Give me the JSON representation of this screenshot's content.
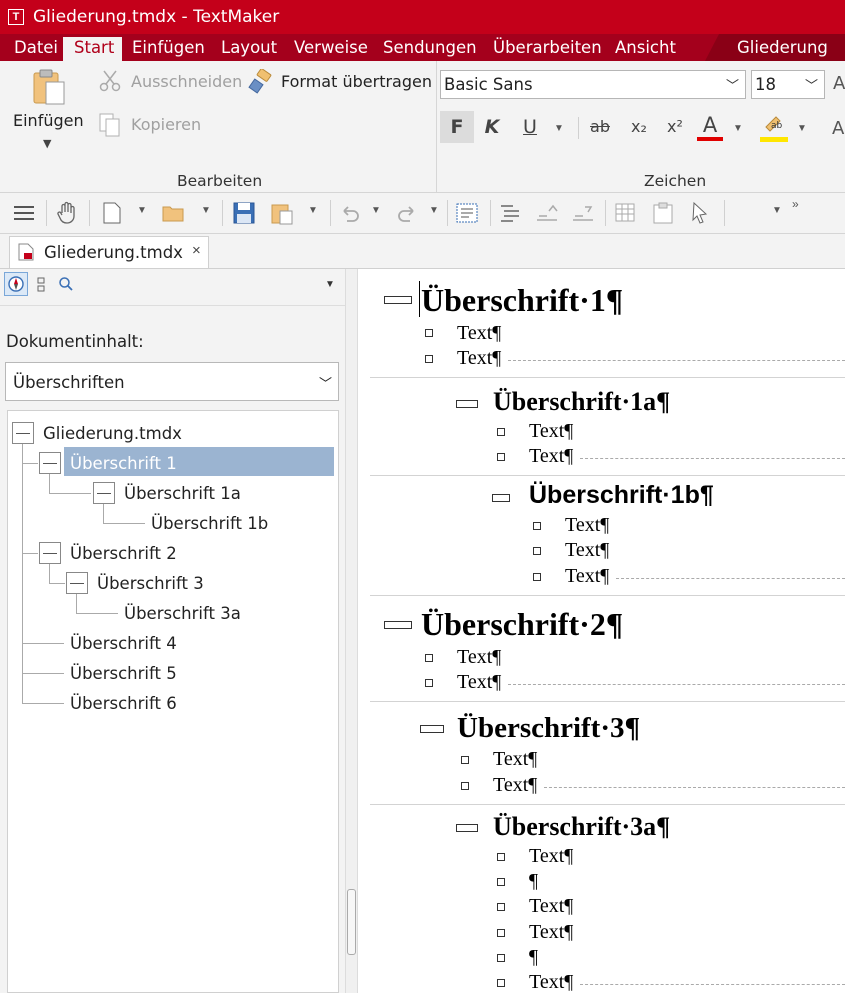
{
  "window": {
    "title": "Gliederung.tmdx - TextMaker",
    "app_icon_letter": "T"
  },
  "menu": {
    "items": [
      "Datei",
      "Start",
      "Einfügen",
      "Layout",
      "Verweise",
      "Sendungen",
      "Überarbeiten",
      "Ansicht",
      "Gliederung"
    ],
    "active": "Start"
  },
  "ribbon": {
    "bearbeiten": {
      "label": "Bearbeiten",
      "paste": "Einfügen",
      "cut": "Ausschneiden",
      "format_painter": "Format übertragen",
      "copy": "Kopieren"
    },
    "zeichen": {
      "label": "Zeichen",
      "font": "Basic Sans",
      "size": "18",
      "bold": "F",
      "italic": "K",
      "underline": "U",
      "strike": "ab",
      "subscript": "x₂",
      "superscript": "x²",
      "font_color": "A",
      "highlight": "ab",
      "highlight_color": "#ffe600",
      "font_color_bar": "#e00000"
    }
  },
  "tab": {
    "label": "Gliederung.tmdx",
    "close": "×"
  },
  "navigator": {
    "content_label": "Dokumentinhalt:",
    "content_select": "Überschriften",
    "tree": [
      "Gliederung.tmdx",
      "Überschrift 1",
      "Überschrift 1a",
      "Überschrift 1b",
      "Überschrift 2",
      "Überschrift 3",
      "Überschrift 3a",
      "Überschrift 4",
      "Überschrift 5",
      "Überschrift 6"
    ],
    "selected": "Überschrift 1"
  },
  "document": {
    "h1": "Überschrift·1¶",
    "h1a": "Überschrift·1a¶",
    "h1b": "Überschrift·1b¶",
    "h2": "Überschrift·2¶",
    "h3": "Überschrift·3¶",
    "h3a": "Überschrift·3a¶",
    "text": "Text¶",
    "empty": "¶"
  },
  "colors": {
    "accent": "#c4001a",
    "menu_bar": "#a4001c",
    "selection": "#9bb4d1"
  }
}
